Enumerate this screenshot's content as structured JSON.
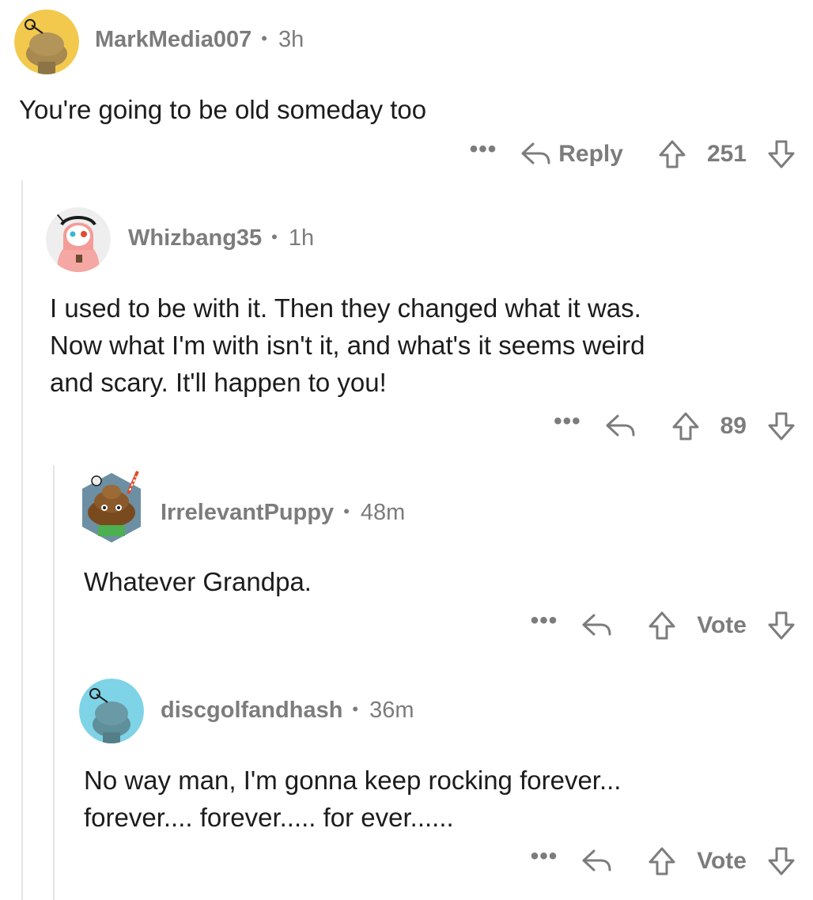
{
  "comments": [
    {
      "author": "MarkMedia007",
      "time": "3h",
      "body": "You're going to be old someday too",
      "reply_label": "Reply",
      "score": "251"
    },
    {
      "author": "Whizbang35",
      "time": "1h",
      "body": "I used to be with it. Then they changed what it was.\nNow what I'm with isn't it, and what's it seems weird\nand scary. It'll happen to you!",
      "reply_label": "",
      "score": "89"
    },
    {
      "author": "IrrelevantPuppy",
      "time": "48m",
      "body": "Whatever Grandpa.",
      "reply_label": "",
      "score": "Vote"
    },
    {
      "author": "discgolfandhash",
      "time": "36m",
      "body": "No way man, I'm gonna keep rocking forever...\nforever.... forever..... for ever......",
      "reply_label": "",
      "score": "Vote"
    }
  ],
  "separator": "•",
  "more_glyph": "•••",
  "colors": {
    "meta_text": "#7c7c7c",
    "body_text": "#1c1c1c",
    "thread_line": "#e5e5e5",
    "avatar_yellow": "#f2c94c",
    "avatar_cyan": "#7ed3e6",
    "avatar_light": "#eeeeee"
  },
  "icons": {
    "more": "more-dots-icon",
    "reply": "reply-arrow-icon",
    "upvote": "upvote-arrow-icon",
    "downvote": "downvote-arrow-icon"
  }
}
